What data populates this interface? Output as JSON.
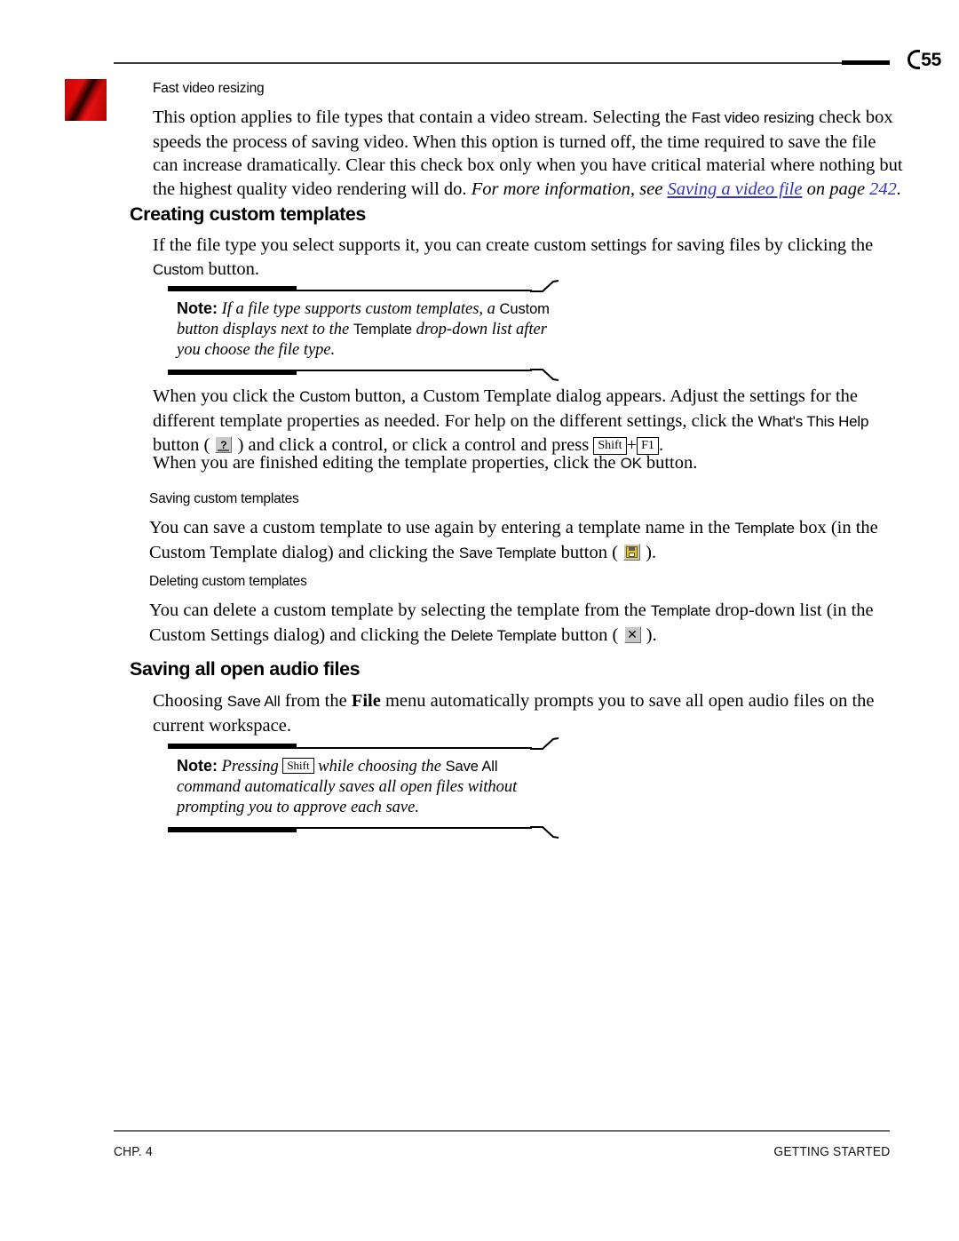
{
  "page": {
    "number": "55",
    "chapter_icon": "red-gradient-square",
    "background": "#ffffff",
    "link_color": "#3333cc"
  },
  "sections": {
    "fast_video_resizing": {
      "heading": "Fast video resizing",
      "paragraph": {
        "part1": "This option applies to file types that contain a video stream. Selecting the ",
        "ui1": "Fast video resizing",
        "part2": " check box speeds the process of saving video. When this option is turned off, the time required to save the file can increase dramatically. Clear this check box only when you have critical material where nothing but the highest quality video rendering will do. ",
        "italic_lead": "For more information, see ",
        "link_text": "Saving a video file",
        "italic_mid": " on page ",
        "link_page": "242",
        "italic_end": "."
      }
    },
    "creating_custom_templates": {
      "heading": "Creating custom templates",
      "paragraph": {
        "part1": "If the file type you select supports it, you can create custom settings for saving files by clicking the ",
        "ui1": "Custom",
        "part2": " button."
      },
      "note": {
        "label": "Note:",
        "part1": " If a file type supports custom templates, a ",
        "ui1": "Custom",
        "part2": " button displays next to the ",
        "ui2": "Template",
        "part3": " drop-down list after you choose the file type."
      },
      "paragraph2": {
        "part1": "When you click the ",
        "ui1": "Custom",
        "part2": " button, a Custom Template dialog appears. Adjust the settings for the different template properties as needed. For help on the different settings, click the ",
        "ui2": "What's This Help",
        "part3": " button ( ",
        "icon1": "help-question-button",
        "part4": " ) and click a control, or click a control and press ",
        "key1": "Shift",
        "plus": "+",
        "key2": "F1",
        "part5": "."
      },
      "paragraph3": {
        "part1": "When you are finished editing the template properties, click the ",
        "ui1": "OK",
        "part2": " button."
      }
    },
    "saving_custom_templates": {
      "heading": "Saving custom templates",
      "paragraph": {
        "part1": "You can save a custom template to use again by entering a template name in the ",
        "ui1": "Template",
        "part2": " box (in the Custom Template dialog) and clicking the ",
        "ui2": "Save Template",
        "part3": " button ( ",
        "icon1": "save-floppy-button",
        "part4": " )."
      }
    },
    "deleting_custom_templates": {
      "heading": "Deleting custom templates",
      "paragraph": {
        "part1": "You can delete a custom template by selecting the template from the ",
        "ui1": "Template",
        "part2": " drop-down list (in the Custom Settings dialog) and clicking the ",
        "ui2": "Delete Template",
        "part3": " button ( ",
        "icon1": "delete-x-button",
        "part4": " )."
      }
    },
    "saving_all_open_audio_files": {
      "heading": "Saving all open audio files",
      "paragraph": {
        "part1": "Choosing ",
        "ui1": "Save All",
        "part2": " from the ",
        "bold1": "File",
        "part3": " menu automatically prompts you to save all open audio files on the current workspace."
      },
      "note": {
        "label": "Note:",
        "part1": " Pressing ",
        "key1": "Shift",
        "part2": " while choosing the ",
        "ui1": "Save All",
        "part3": " command automatically saves all open files without prompting you to approve each save."
      }
    }
  },
  "footer": {
    "left": "CHP. 4",
    "right": "GETTING STARTED"
  }
}
